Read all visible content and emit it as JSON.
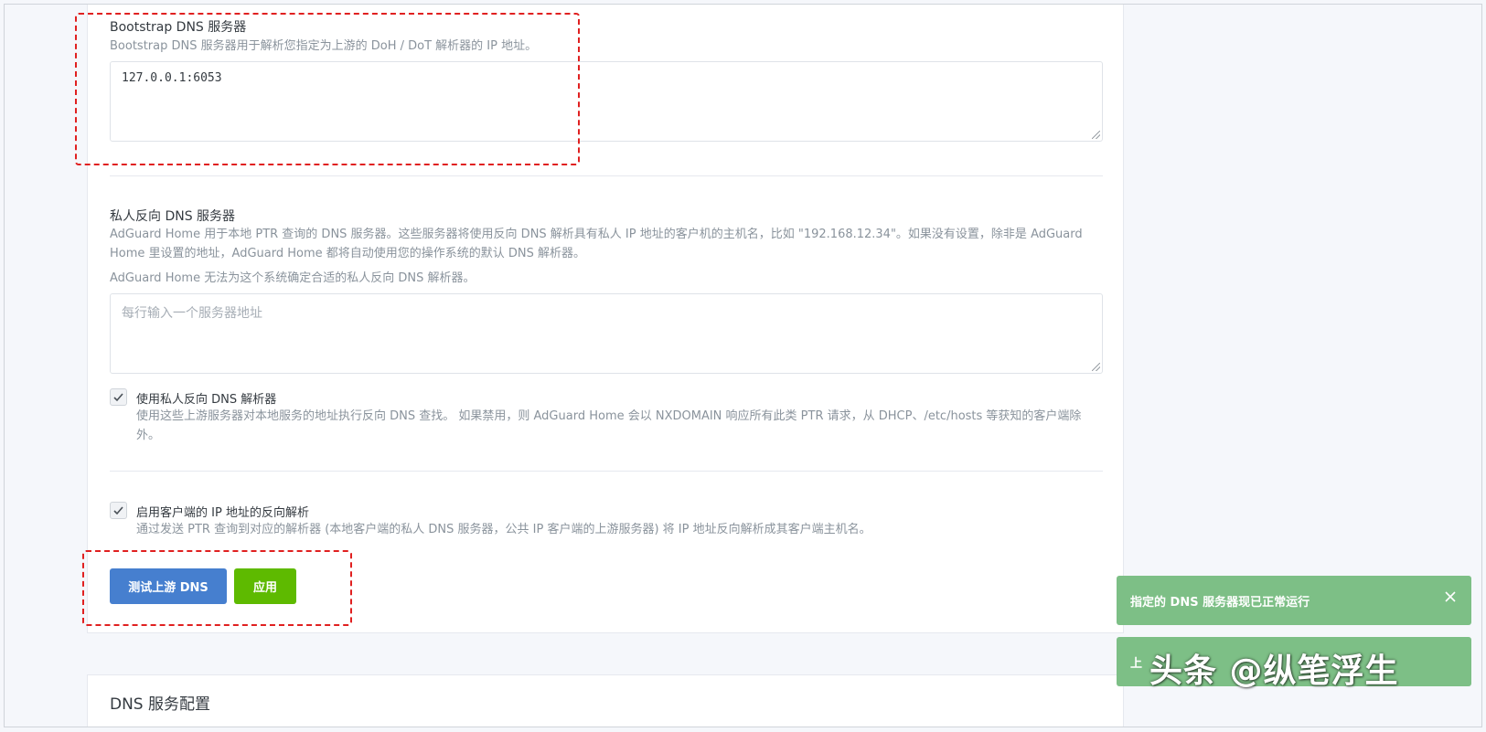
{
  "bootstrap": {
    "title": "Bootstrap DNS 服务器",
    "help": "Bootstrap DNS 服务器用于解析您指定为上游的 DoH / DoT 解析器的 IP 地址。",
    "value": "127.0.0.1:6053"
  },
  "private_reverse": {
    "title": "私人反向 DNS 服务器",
    "help": "AdGuard Home 用于本地 PTR 查询的 DNS 服务器。这些服务器将使用反向 DNS 解析具有私人 IP 地址的客户机的主机名，比如 \"192.168.12.34\"。如果没有设置，除非是 AdGuard Home 里设置的地址，AdGuard Home 都将自动使用您的操作系统的默认 DNS 解析器。",
    "warning": "AdGuard Home 无法为这个系统确定合适的私人反向 DNS 解析器。",
    "placeholder": "每行输入一个服务器地址",
    "checkbox_label": "使用私人反向 DNS 解析器",
    "checkbox_help": "使用这些上游服务器对本地服务的地址执行反向 DNS 查找。 如果禁用，则 AdGuard Home 会以 NXDOMAIN 响应所有此类 PTR 请求，从 DHCP、/etc/hosts 等获知的客户端除外。",
    "checkbox_checked": true
  },
  "client_rdns": {
    "label": "启用客户端的 IP 地址的反向解析",
    "help": "通过发送 PTR 查询到对应的解析器 (本地客户端的私人 DNS 服务器，公共 IP 客户端的上游服务器) 将 IP 地址反向解析成其客户端主机名。",
    "checked": true
  },
  "buttons": {
    "test": "测试上游 DNS",
    "apply": "应用"
  },
  "next_section": {
    "title": "DNS 服务配置"
  },
  "toasts": [
    {
      "text": "指定的 DNS 服务器现已正常运行"
    },
    {
      "text": "上"
    }
  ],
  "watermark": "头条 @纵笔浮生",
  "colors": {
    "primary": "#467fcf",
    "success": "#5eba00",
    "toast": "#7dbf86",
    "annotation": "#e02020"
  }
}
